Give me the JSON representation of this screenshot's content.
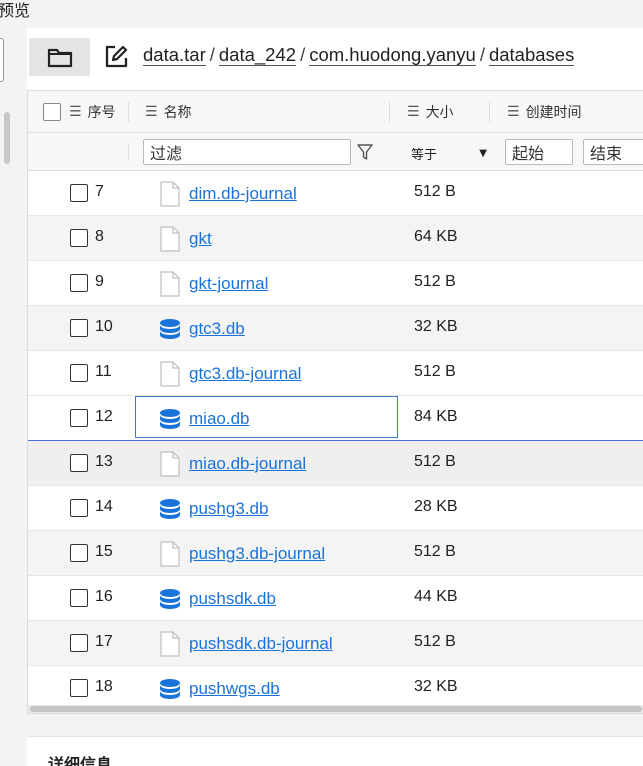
{
  "window": {
    "title": "预览"
  },
  "toolbar": {
    "folder_icon": "folder-icon",
    "edit_icon": "edit-icon",
    "breadcrumb": [
      "data.tar",
      "data_242",
      "com.huodong.yanyu",
      "databases"
    ]
  },
  "columns": {
    "index": "序号",
    "name": "名称",
    "size": "大小",
    "created": "创建时间"
  },
  "filters": {
    "name_placeholder": "过滤",
    "size_operator": "等于",
    "start_placeholder": "起始",
    "end_placeholder": "结束"
  },
  "rows": [
    {
      "index": "7",
      "name": "dim.db-journal",
      "size": "512 B",
      "icon": "file-icon"
    },
    {
      "index": "8",
      "name": "gkt",
      "size": "64 KB",
      "icon": "file-icon"
    },
    {
      "index": "9",
      "name": "gkt-journal",
      "size": "512 B",
      "icon": "file-icon"
    },
    {
      "index": "10",
      "name": "gtc3.db",
      "size": "32 KB",
      "icon": "database-icon"
    },
    {
      "index": "11",
      "name": "gtc3.db-journal",
      "size": "512 B",
      "icon": "file-icon"
    },
    {
      "index": "12",
      "name": "miao.db",
      "size": "84 KB",
      "icon": "database-icon"
    },
    {
      "index": "13",
      "name": "miao.db-journal",
      "size": "512 B",
      "icon": "file-icon"
    },
    {
      "index": "14",
      "name": "pushg3.db",
      "size": "28 KB",
      "icon": "database-icon"
    },
    {
      "index": "15",
      "name": "pushg3.db-journal",
      "size": "512 B",
      "icon": "file-icon"
    },
    {
      "index": "16",
      "name": "pushsdk.db",
      "size": "44 KB",
      "icon": "database-icon"
    },
    {
      "index": "17",
      "name": "pushsdk.db-journal",
      "size": "512 B",
      "icon": "file-icon"
    },
    {
      "index": "18",
      "name": "pushwgs.db",
      "size": "32 KB",
      "icon": "database-icon"
    }
  ],
  "detail": {
    "title": "详细信息"
  },
  "colors": {
    "link": "#1a73d9",
    "db_icon": "#1a73d9",
    "focus": "#3a78c9",
    "selected_line": "#4b6fe0"
  }
}
